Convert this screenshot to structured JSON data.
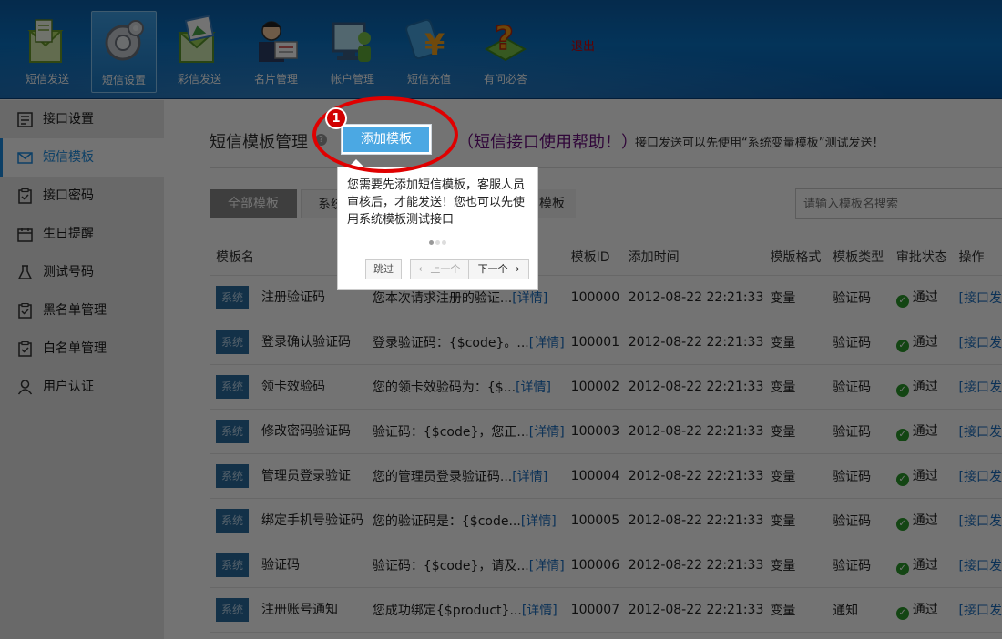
{
  "nav": {
    "items": [
      {
        "label": "短信发送",
        "icon": "sms-send-icon"
      },
      {
        "label": "短信设置",
        "icon": "gear-settings-icon"
      },
      {
        "label": "彩信发送",
        "icon": "mms-send-icon"
      },
      {
        "label": "名片管理",
        "icon": "contact-card-icon"
      },
      {
        "label": "帐户管理",
        "icon": "account-icon"
      },
      {
        "label": "短信充值",
        "icon": "yen-recharge-icon"
      },
      {
        "label": "有问必答",
        "icon": "question-icon"
      }
    ],
    "logout": "退出"
  },
  "sidebar": {
    "items": [
      {
        "label": "接口设置",
        "icon": "interface-icon"
      },
      {
        "label": "短信模板",
        "icon": "envelope-icon"
      },
      {
        "label": "接口密码",
        "icon": "clipboard-icon"
      },
      {
        "label": "生日提醒",
        "icon": "calendar-icon"
      },
      {
        "label": "测试号码",
        "icon": "flask-icon"
      },
      {
        "label": "黑名单管理",
        "icon": "clipboard-icon"
      },
      {
        "label": "白名单管理",
        "icon": "clipboard-icon"
      },
      {
        "label": "用户认证",
        "icon": "user-icon"
      }
    ]
  },
  "main": {
    "title": "短信模板管理",
    "help_mark": "?",
    "add_button": "添加模板",
    "help_link": "（短信接口使用帮助！）",
    "help_note": "接口发送可以先使用“系统变量模板”测试发送！",
    "filters": {
      "all": "全部模板",
      "system": "系统",
      "mine": "模板"
    },
    "search_placeholder": "请输入模板名搜索",
    "columns": [
      "模板名",
      "",
      "模板ID",
      "添加时间",
      "模版格式",
      "模板类型",
      "审批状态",
      "操作"
    ],
    "rows": [
      {
        "tag": "系统",
        "name": "注册验证码",
        "content": "您本次请求注册的验证...",
        "detail": "[详情]",
        "id": "100000",
        "time": "2012-08-22 22:21:33",
        "format": "变量",
        "type": "验证码",
        "status": "通过",
        "op": "[接口发"
      },
      {
        "tag": "系统",
        "name": "登录确认验证码",
        "content": "登录验证码：{$code}。...",
        "detail": "[详情]",
        "id": "100001",
        "time": "2012-08-22 22:21:33",
        "format": "变量",
        "type": "验证码",
        "status": "通过",
        "op": "[接口发"
      },
      {
        "tag": "系统",
        "name": "领卡效验码",
        "content": "您的领卡效验码为：{$...",
        "detail": "[详情]",
        "id": "100002",
        "time": "2012-08-22 22:21:33",
        "format": "变量",
        "type": "验证码",
        "status": "通过",
        "op": "[接口发"
      },
      {
        "tag": "系统",
        "name": "修改密码验证码",
        "content": "验证码：{$code}，您正...",
        "detail": "[详情]",
        "id": "100003",
        "time": "2012-08-22 22:21:33",
        "format": "变量",
        "type": "验证码",
        "status": "通过",
        "op": "[接口发"
      },
      {
        "tag": "系统",
        "name": "管理员登录验证",
        "content": "您的管理员登录验证码...",
        "detail": "[详情]",
        "id": "100004",
        "time": "2012-08-22 22:21:33",
        "format": "变量",
        "type": "验证码",
        "status": "通过",
        "op": "[接口发"
      },
      {
        "tag": "系统",
        "name": "绑定手机号验证码",
        "content": "您的验证码是：{$code...",
        "detail": "[详情]",
        "id": "100005",
        "time": "2012-08-22 22:21:33",
        "format": "变量",
        "type": "验证码",
        "status": "通过",
        "op": "[接口发"
      },
      {
        "tag": "系统",
        "name": "验证码",
        "content": "验证码：{$code}，请及...",
        "detail": "[详情]",
        "id": "100006",
        "time": "2012-08-22 22:21:33",
        "format": "变量",
        "type": "验证码",
        "status": "通过",
        "op": "[接口发"
      },
      {
        "tag": "系统",
        "name": "注册账号通知",
        "content": "您成功绑定{$product}...",
        "detail": "[详情]",
        "id": "100007",
        "time": "2012-08-22 22:21:33",
        "format": "变量",
        "type": "通知",
        "status": "通过",
        "op": "[接口发"
      }
    ]
  },
  "tour": {
    "step": "1",
    "text": "您需要先添加短信模板，客服人员审核后，才能发送！您也可以先使用系统模板测试接口",
    "skip": "跳过",
    "prev": "← 上一个",
    "next": "下一个 →"
  }
}
